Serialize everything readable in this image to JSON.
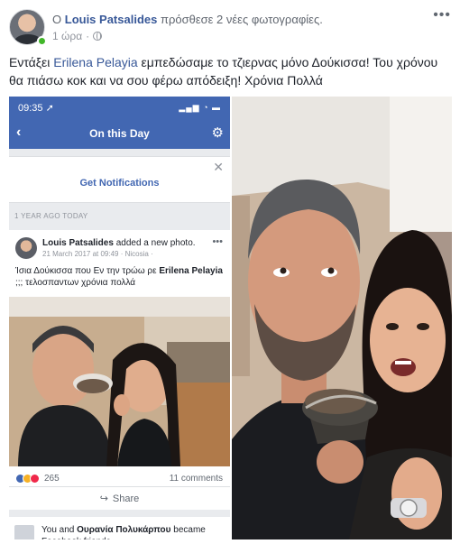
{
  "post": {
    "prefix": "Ο",
    "author": "Louis Patsalides",
    "action": "πρόσθεσε 2 νέες φωτογραφίες.",
    "time": "1 ώρα",
    "dot": "·",
    "more": "•••",
    "text_before": "Εντάξει ",
    "tag": "Erilena Pelayia",
    "text_after": " εμπεδώσαμε το τζιερνας μόνο Δούκισσα! Του χρόνου θα πιάσω κοκ και να σου φέρω απόδειξη! Χρόνια Πολλά"
  },
  "phone": {
    "status_time": "09:35 ➚",
    "status_icons": "▂▄▆ ◔ ▬",
    "nav_back": "‹",
    "nav_title": "On this Day",
    "nav_gear": "⚙",
    "notif_close": "✕",
    "notif_label": "Get Notifications",
    "section_label": "1 YEAR AGO TODAY",
    "memory": {
      "author": "Louis Patsalides",
      "action": " added a new photo.",
      "meta": "21 March 2017 at 09:49 · Nicosia ·",
      "more": "•••",
      "text_before": "Ίσια Δούκισσα που Εν την τρώω ρε ",
      "tag": "Erilena Pelayia",
      "text_after": " ;;; τελοσπαντων χρόνια πολλά",
      "reaction_count": "265",
      "comments": "11 comments",
      "share": "Share"
    },
    "friends": {
      "prefix": "You and ",
      "name": "Ουρανία Πολυκάρπου",
      "suffix": " became Facebook friends"
    }
  },
  "colors": {
    "facebook_blue": "#4267b2",
    "link_blue": "#385898",
    "online_green": "#42b72a"
  }
}
